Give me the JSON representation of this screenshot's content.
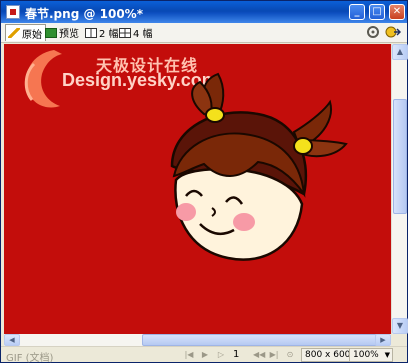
{
  "window": {
    "title": "春节.png @ 100%*",
    "buttons": {
      "minimize": "_",
      "maximize": "□",
      "close": "✕"
    }
  },
  "toolbar": {
    "tabs": [
      {
        "label": "原始",
        "icon": "pencil-icon"
      },
      {
        "label": "预览",
        "icon": "preview-icon"
      },
      {
        "label": "2 幅",
        "icon": "two-up-icon"
      },
      {
        "label": "4 幅",
        "icon": "four-up-icon"
      }
    ],
    "active_tab": "原始"
  },
  "watermark": {
    "chinese": "天极设计在线",
    "english": "Design.yesky.com"
  },
  "canvas": {
    "background": "#c30d0b"
  },
  "statusbar": {
    "format": "GIF (文档)",
    "frame": "1",
    "dimensions": "800 x 600",
    "zoom": "100%"
  }
}
